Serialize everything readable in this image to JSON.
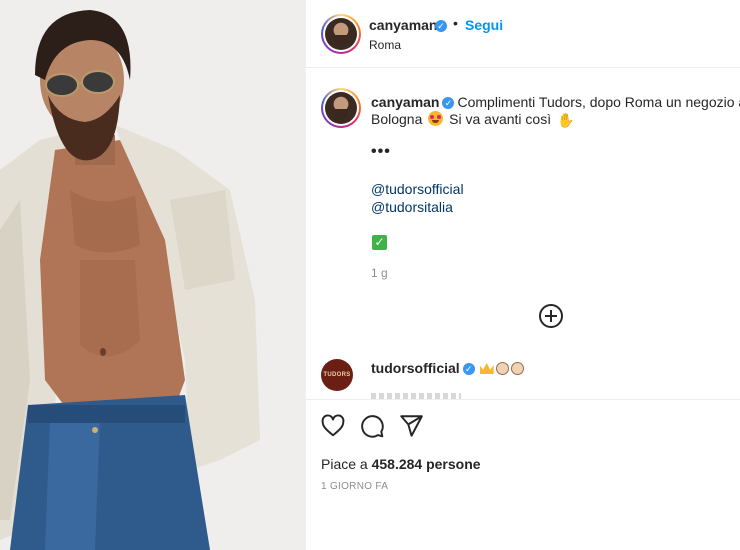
{
  "post": {
    "username": "canyaman",
    "follow_label": "Segui",
    "separator": "•",
    "location": "Roma",
    "photo_alt": "canyaman post photo"
  },
  "caption": {
    "username": "canyaman",
    "text_line1": "Complimenti Tudors, dopo Roma un negozio an",
    "text_line2": "Bologna",
    "text_line2_tail": "Si va avanti così",
    "ellipsis": "•••",
    "mentions": [
      "@tudorsofficial",
      "@tudorsitalia"
    ],
    "check_emoji": "✓",
    "time": "1 g"
  },
  "reply": {
    "avatar_text": "TUDORS",
    "username": "tudorsofficial"
  },
  "actions": {
    "like_icon": "heart-icon",
    "comment_icon": "comment-icon",
    "share_icon": "share-icon",
    "likes_prefix": "Piace a",
    "likes_count": "458.284",
    "likes_suffix": "persone",
    "posted_ago": "1 GIORNO FA"
  },
  "colors": {
    "follow_blue": "#0095f6",
    "verified_blue": "#3897f0",
    "mention_blue": "#00376b",
    "muted": "#8e8e8e"
  }
}
